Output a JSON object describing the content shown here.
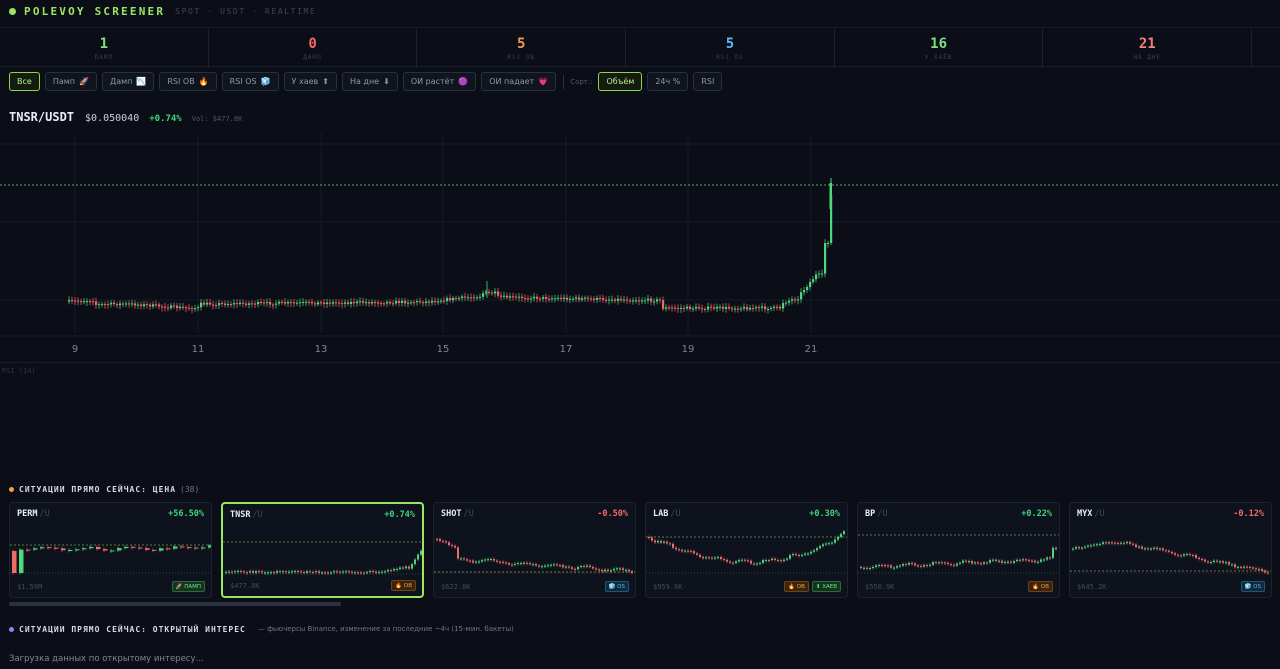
{
  "header": {
    "brand": "POLEVOY SCREENER",
    "subtitle": "SPOT · USDT · REALTIME"
  },
  "stats": [
    {
      "value": "1",
      "label": "ПАМП",
      "color": "#7ee081"
    },
    {
      "value": "0",
      "label": "ДАМП",
      "color": "#f46a6a"
    },
    {
      "value": "5",
      "label": "RSI OB",
      "color": "#f29a4a"
    },
    {
      "value": "5",
      "label": "RSI OS",
      "color": "#5db6ee"
    },
    {
      "value": "16",
      "label": "У ХАЁВ",
      "color": "#7ee081"
    },
    {
      "value": "21",
      "label": "НА ДНЕ",
      "color": "#f37f7f"
    }
  ],
  "filters": [
    {
      "label": "Все",
      "icon": "",
      "active": true
    },
    {
      "label": "Памп",
      "icon": "🚀",
      "active": false
    },
    {
      "label": "Дамп",
      "icon": "📉",
      "active": false
    },
    {
      "label": "RSI OB",
      "icon": "🔥",
      "active": false
    },
    {
      "label": "RSI OS",
      "icon": "🧊",
      "active": false
    },
    {
      "label": "У хаев",
      "icon": "⬆",
      "active": false
    },
    {
      "label": "На дне",
      "icon": "⬇",
      "active": false
    },
    {
      "label": "ОИ растёт",
      "icon": "🟣",
      "active": false
    },
    {
      "label": "ОИ падает",
      "icon": "💗",
      "active": false
    }
  ],
  "sort": {
    "label": "Сорт.:",
    "options": [
      {
        "label": "Объём",
        "active": true
      },
      {
        "label": "24ч %",
        "active": false
      },
      {
        "label": "RSI",
        "active": false
      }
    ]
  },
  "ticker": {
    "symbol": "TNSR/USDT",
    "price": "$0.050040",
    "change": "+0.74%",
    "volume": "Vol: $477.8K"
  },
  "chart_data": {
    "type": "candlestick",
    "x_ticks": [
      "9",
      "11",
      "13",
      "15",
      "17",
      "19",
      "21"
    ],
    "reference_line": "last price",
    "up_color": "#4fd67e",
    "down_color": "#f26b6b"
  },
  "rsi": {
    "label": "RSI (14)"
  },
  "price_section": {
    "title": "СИТУАЦИИ ПРЯМО СЕЙЧАС: ЦЕНА",
    "count": "(38)",
    "dot_color": "#f2a33a"
  },
  "cards": [
    {
      "symbol": "PERM",
      "quote": "/U",
      "change": "+56.50%",
      "positive": true,
      "volume": "$1.59M",
      "selected": false,
      "badges": [
        {
          "text": "🚀 ПАМП",
          "kind": "pump"
        }
      ],
      "shape": "perm"
    },
    {
      "symbol": "TNSR",
      "quote": "/U",
      "change": "+0.74%",
      "positive": true,
      "volume": "$477.8K",
      "selected": true,
      "badges": [
        {
          "text": "🔥 OB",
          "kind": "ob"
        }
      ],
      "shape": "tnsr"
    },
    {
      "symbol": "SHOT",
      "quote": "/U",
      "change": "-0.50%",
      "positive": false,
      "volume": "$622.8K",
      "selected": false,
      "badges": [
        {
          "text": "🧊 OS",
          "kind": "os"
        }
      ],
      "shape": "shot"
    },
    {
      "symbol": "LAB",
      "quote": "/U",
      "change": "+0.30%",
      "positive": true,
      "volume": "$959.6K",
      "selected": false,
      "badges": [
        {
          "text": "🔥 OB",
          "kind": "ob"
        },
        {
          "text": "⬆ ХАЕВ",
          "kind": "high"
        }
      ],
      "shape": "lab"
    },
    {
      "symbol": "BP",
      "quote": "/U",
      "change": "+0.22%",
      "positive": true,
      "volume": "$550.9K",
      "selected": false,
      "badges": [
        {
          "text": "🔥 OB",
          "kind": "ob"
        }
      ],
      "shape": "bp"
    },
    {
      "symbol": "MYX",
      "quote": "/U",
      "change": "-0.12%",
      "positive": false,
      "volume": "$645.2K",
      "selected": false,
      "badges": [
        {
          "text": "🧊 OS",
          "kind": "os"
        }
      ],
      "shape": "myx"
    }
  ],
  "oi_section": {
    "title": "СИТУАЦИИ ПРЯМО СЕЙЧАС: ОТКРЫТЫЙ ИНТЕРЕС",
    "note": "— фьючерсы Binance, изменение за последние ~4ч (15-мин. бакеты)",
    "dot_color": "#a77bf0",
    "loading": "Загрузка данных по открытому интересу…"
  }
}
